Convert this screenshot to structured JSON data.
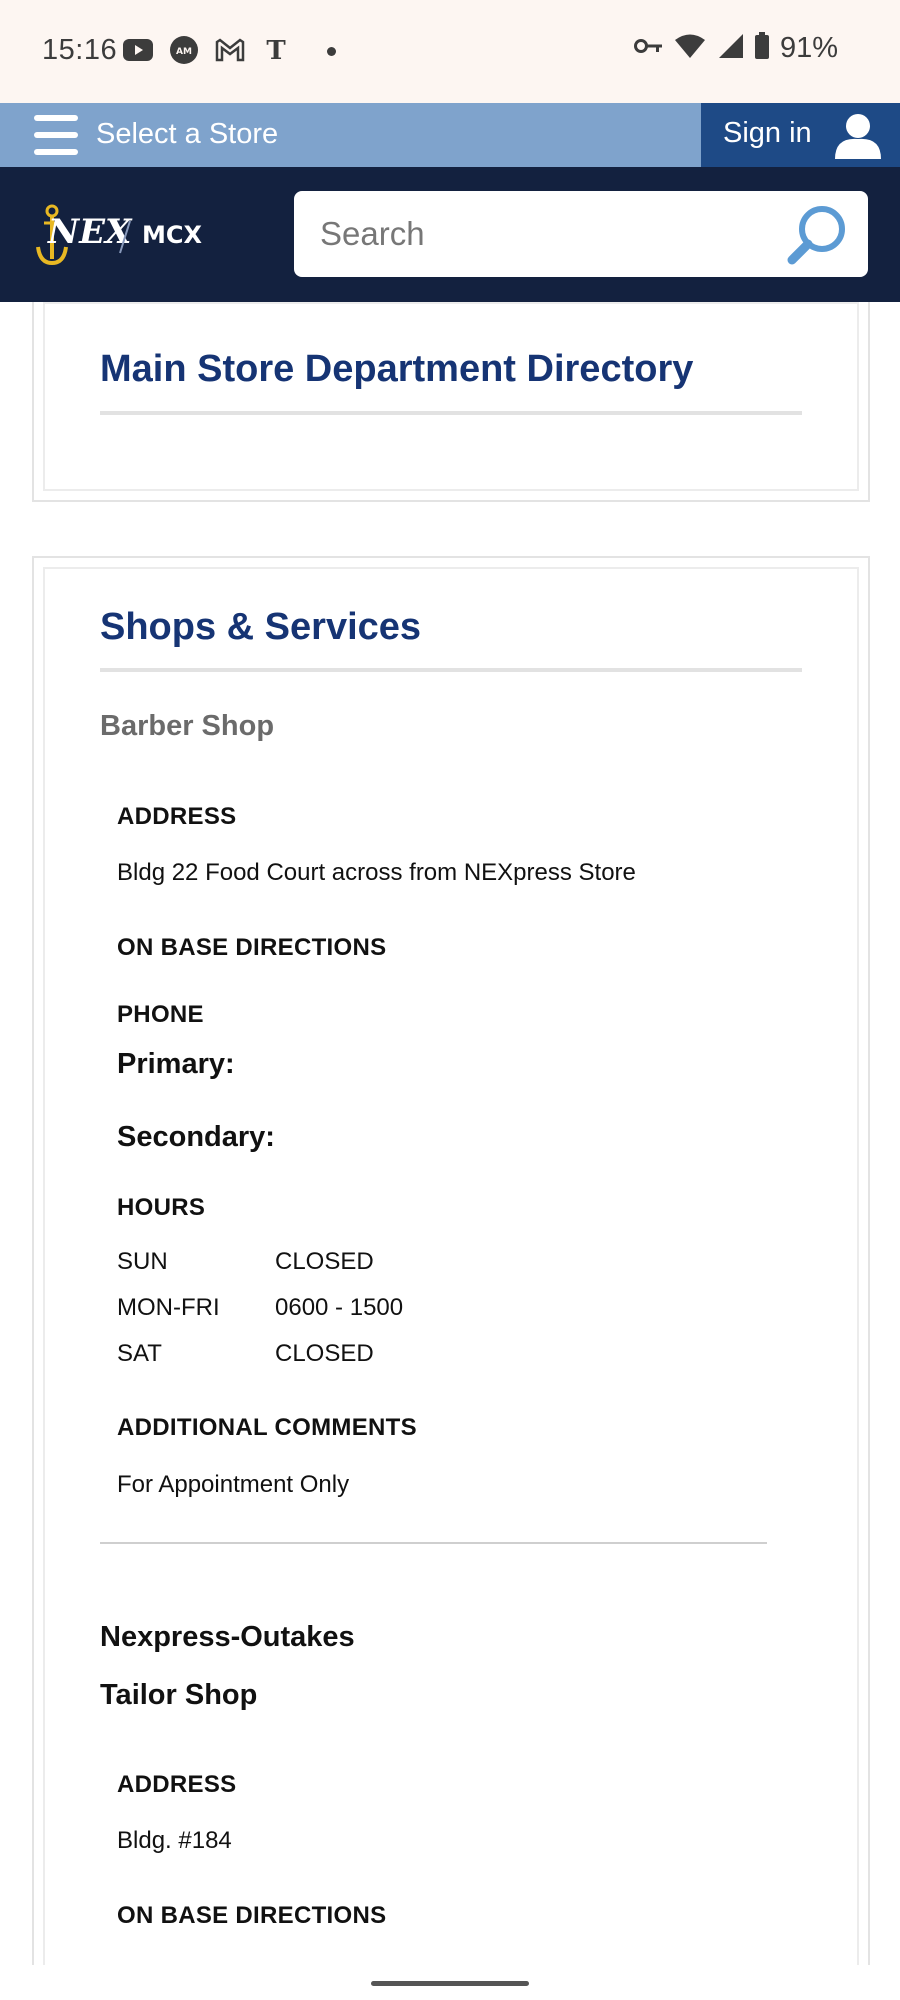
{
  "status_bar": {
    "time": "15:16",
    "battery": "91%",
    "icons": [
      "youtube-icon",
      "amex-icon",
      "gmail-icon",
      "nytimes-icon",
      "vpn-key-icon",
      "wifi-icon",
      "signal-icon",
      "battery-icon"
    ]
  },
  "store_bar": {
    "select_store": "Select a Store",
    "sign_in": "Sign in"
  },
  "header": {
    "logo_text": "NEX / MCX",
    "search_placeholder": "Search"
  },
  "department": {
    "title": "Main Store Department Directory"
  },
  "shops": {
    "title": "Shops & Services",
    "barber": {
      "name": "Barber Shop",
      "address_label": "ADDRESS",
      "address": "Bldg 22 Food Court across from NEXpress Store",
      "directions_label": "ON BASE DIRECTIONS",
      "phone_label": "PHONE",
      "primary_label": "Primary:",
      "secondary_label": "Secondary:",
      "hours_label": "HOURS",
      "hours": [
        {
          "day": "SUN",
          "time": "CLOSED"
        },
        {
          "day": "MON-FRI",
          "time": "0600 - 1500"
        },
        {
          "day": "SAT",
          "time": "CLOSED"
        }
      ],
      "comments_label": "ADDITIONAL COMMENTS",
      "comments": "For Appointment Only"
    },
    "outakes": {
      "name": "Nexpress-Outakes"
    },
    "tailor": {
      "name": "Tailor Shop",
      "address_label": "ADDRESS",
      "address": "Bldg. #184",
      "directions_label": "ON BASE DIRECTIONS"
    }
  },
  "colors": {
    "header_navy": "#13213f",
    "store_bar_blue": "#7fa3cc",
    "sign_in_blue": "#1e4a86",
    "title_blue": "#163474",
    "logo_gold": "#e8b823"
  }
}
